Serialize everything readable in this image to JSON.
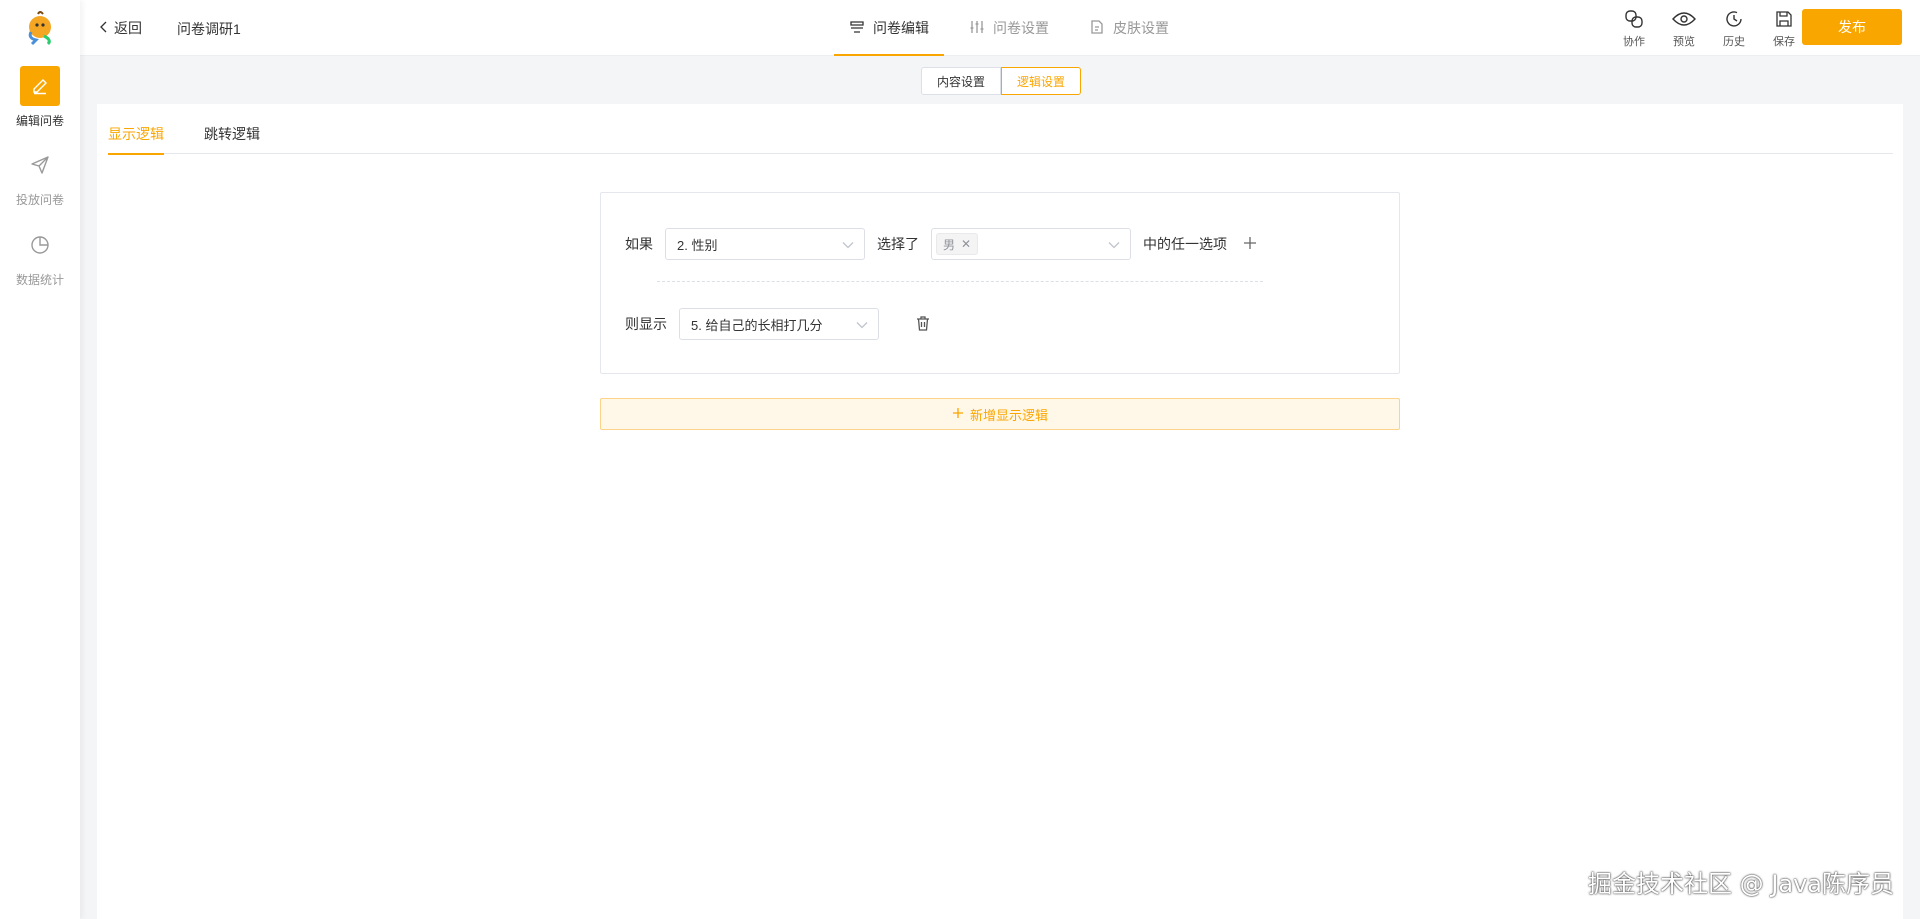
{
  "sidebar": {
    "items": [
      {
        "label": "编辑问卷",
        "icon": "edit-icon",
        "active": true
      },
      {
        "label": "投放问卷",
        "icon": "send-icon",
        "active": false
      },
      {
        "label": "数据统计",
        "icon": "pie-chart-icon",
        "active": false
      }
    ]
  },
  "header": {
    "back_label": "返回",
    "survey_title": "问卷调研1",
    "tabs": [
      {
        "label": "问卷编辑",
        "icon": "list-icon",
        "active": true
      },
      {
        "label": "问卷设置",
        "icon": "sliders-icon",
        "active": false
      },
      {
        "label": "皮肤设置",
        "icon": "skin-icon",
        "active": false
      }
    ],
    "tools": [
      {
        "label": "协作",
        "icon": "link-icon"
      },
      {
        "label": "预览",
        "icon": "eye-icon"
      },
      {
        "label": "历史",
        "icon": "clock-icon"
      },
      {
        "label": "保存",
        "icon": "save-icon"
      }
    ],
    "publish_label": "发布"
  },
  "mode_switch": {
    "options": [
      "内容设置",
      "逻辑设置"
    ],
    "selected": "逻辑设置"
  },
  "logic_tabs": {
    "items": [
      "显示逻辑",
      "跳转逻辑"
    ],
    "active": "显示逻辑"
  },
  "rule": {
    "if_label": "如果",
    "question_select": "2. 性别",
    "selected_label": "选择了",
    "option_tag": "男",
    "any_option_label": "中的任一选项",
    "then_label": "则显示",
    "target_select": "5. 给自己的长相打几分"
  },
  "add_logic_label": "新增显示逻辑",
  "watermark": "掘金技术社区 @ Java陈序员",
  "colors": {
    "accent": "#faa600",
    "accent_light": "#fff7e8"
  }
}
